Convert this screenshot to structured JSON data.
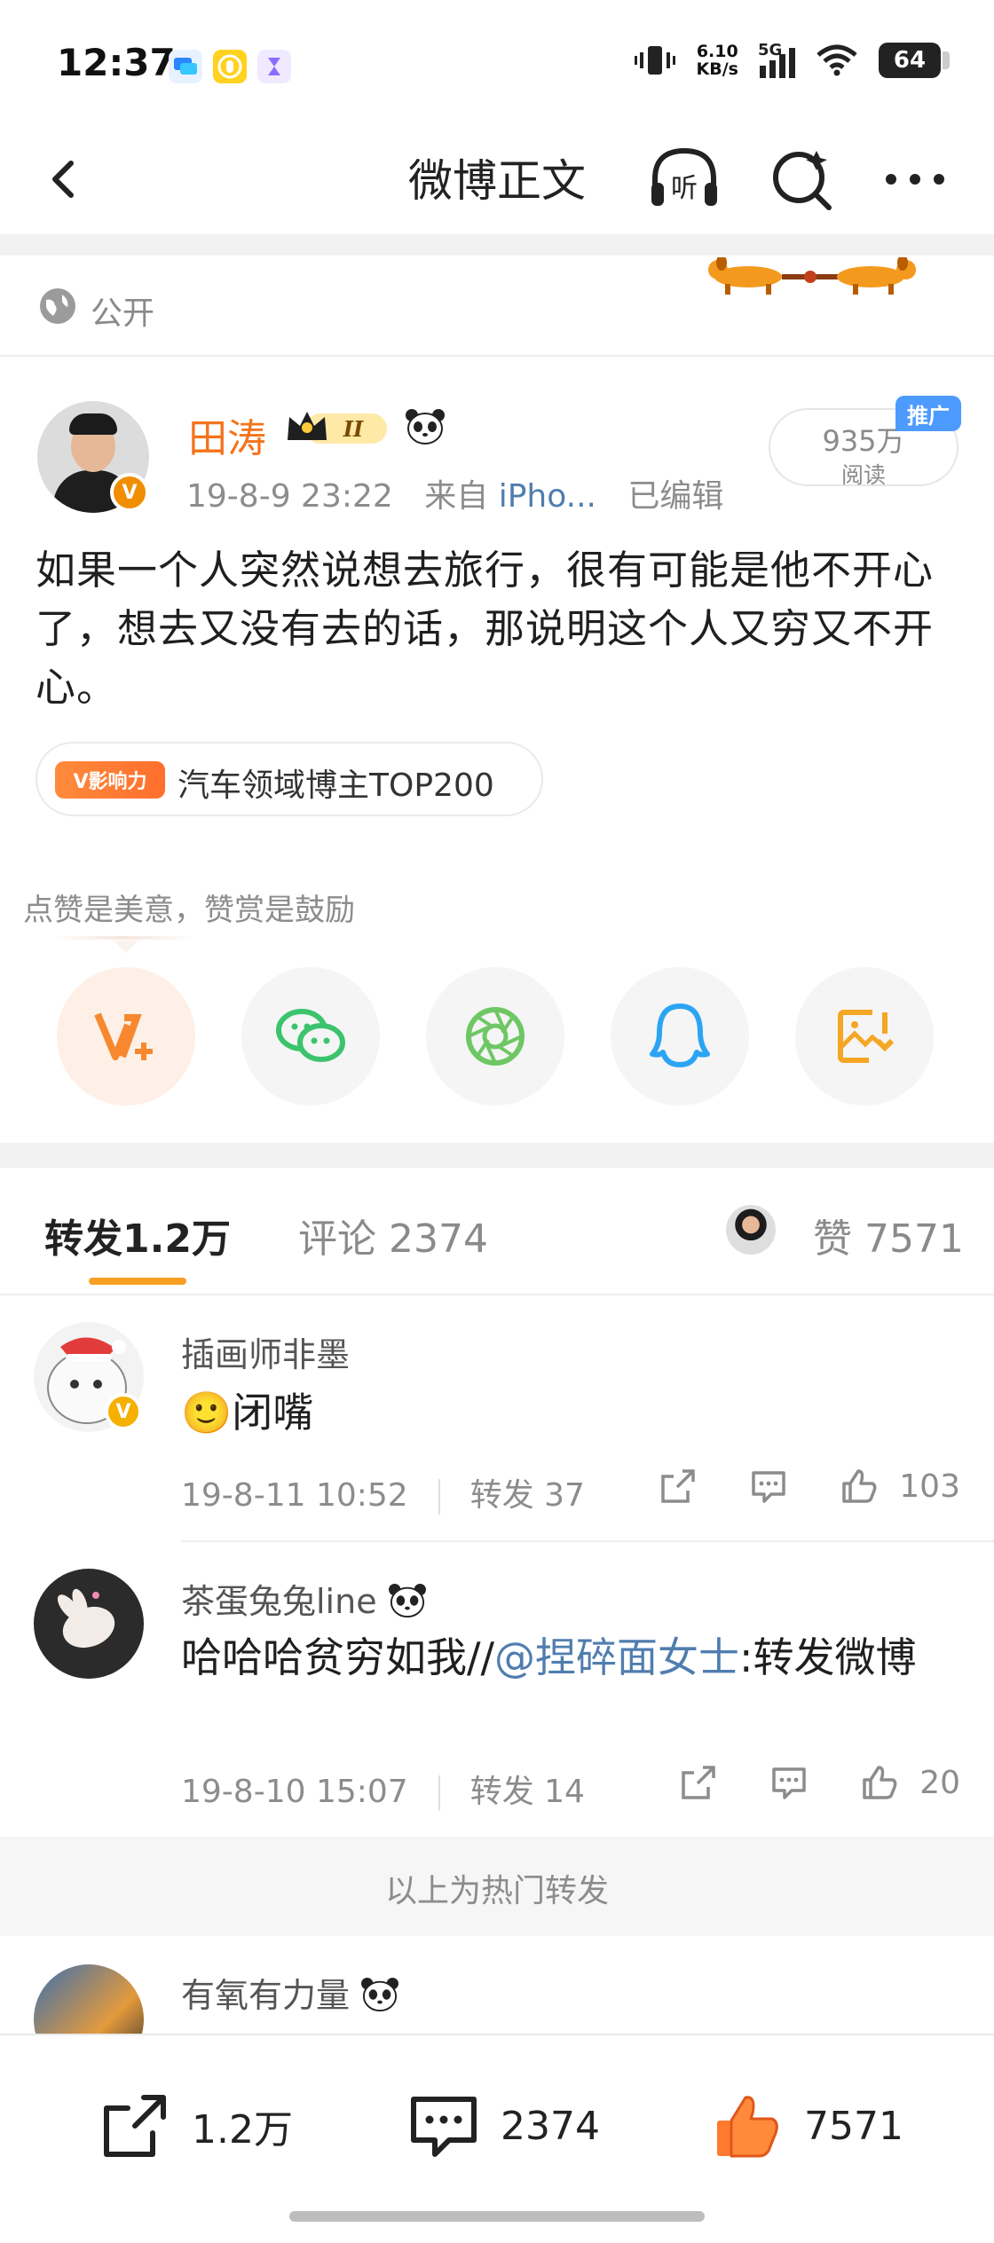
{
  "status_bar": {
    "time": "12:37",
    "net_speed_value": "6.10",
    "net_speed_unit": "KB/s",
    "network": "5G",
    "battery": "64"
  },
  "header": {
    "title": "微博正文",
    "icons": [
      "back-icon",
      "listen-icon",
      "search-icon",
      "more-icon"
    ],
    "listen_label": "听"
  },
  "post": {
    "visibility": "公开",
    "author": "田涛",
    "rank_badge": "II",
    "time": "19-8-9 23:22",
    "source_prefix": "来自",
    "source": "iPho...",
    "edited": "已编辑",
    "reads_count": "935万",
    "reads_label": "阅读",
    "promo_tag": "推广",
    "text": "如果一个人突然说想去旅行，很有可能是他不开心了，想去又没有去的话，那说明这个人又穷又不开心。",
    "influence_badge": "V影响力",
    "influence_text": "汽车领域博主TOP200"
  },
  "reward": {
    "hint": "点赞是美意，赞赏是鼓励",
    "share_targets": [
      "v-plus-icon",
      "wechat-icon",
      "moments-icon",
      "qq-icon",
      "save-image-icon"
    ]
  },
  "tabs": {
    "repost": "转发",
    "repost_count": "1.2万",
    "comment": "评论",
    "comment_count": "2374",
    "like": "赞",
    "like_count": "7571"
  },
  "reposts": [
    {
      "name": "插画师非墨",
      "body": "闭嘴",
      "emoji": "🙂",
      "time": "19-8-11 10:52",
      "repost_label": "转发 37",
      "likes": "103"
    },
    {
      "name": "茶蛋兔兔line",
      "body_prefix": "哈哈哈贫穷如我//",
      "mention": "@捏碎面女士",
      "body_suffix": ":转发微博",
      "time": "19-8-10 15:07",
      "repost_label": "转发 14",
      "likes": "20"
    }
  ],
  "hot_divider": "以上为热门转发",
  "partial_repost": {
    "name": "有氧有力量"
  },
  "bottom_bar": {
    "repost_count": "1.2万",
    "comment_count": "2374",
    "like_count": "7571"
  },
  "colors": {
    "accent_orange": "#f4731b",
    "tab_underline": "#f7a024",
    "link_blue": "#507daf",
    "like_orange": "#ff7a2f"
  }
}
